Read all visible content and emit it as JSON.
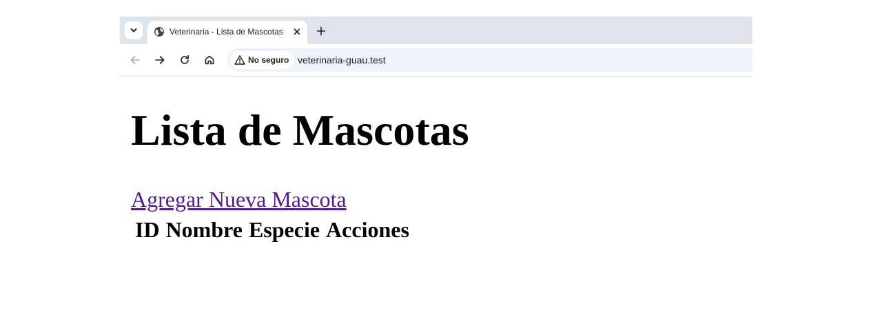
{
  "browser": {
    "tab": {
      "title": "Veterinaria - Lista de Mascotas",
      "favicon": "globe-icon"
    },
    "tab_search_icon": "chevron-down-icon",
    "new_tab_icon": "plus-icon",
    "toolbar": {
      "back_icon": "arrow-left-icon",
      "forward_icon": "arrow-right-icon",
      "reload_icon": "reload-icon",
      "home_icon": "home-icon"
    },
    "address_bar": {
      "security_label": "No seguro",
      "security_icon": "warning-icon",
      "url": "veterinaria-guau.test"
    }
  },
  "page": {
    "title": "Lista de Mascotas",
    "add_link": "Agregar Nueva Mascota",
    "table": {
      "columns": [
        "ID",
        "Nombre",
        "Especie",
        "Acciones"
      ]
    }
  },
  "colors": {
    "tabstrip_bg": "#dfe3ea",
    "omnibox_bg": "#eef2fb",
    "visited_link": "#551a8b"
  }
}
